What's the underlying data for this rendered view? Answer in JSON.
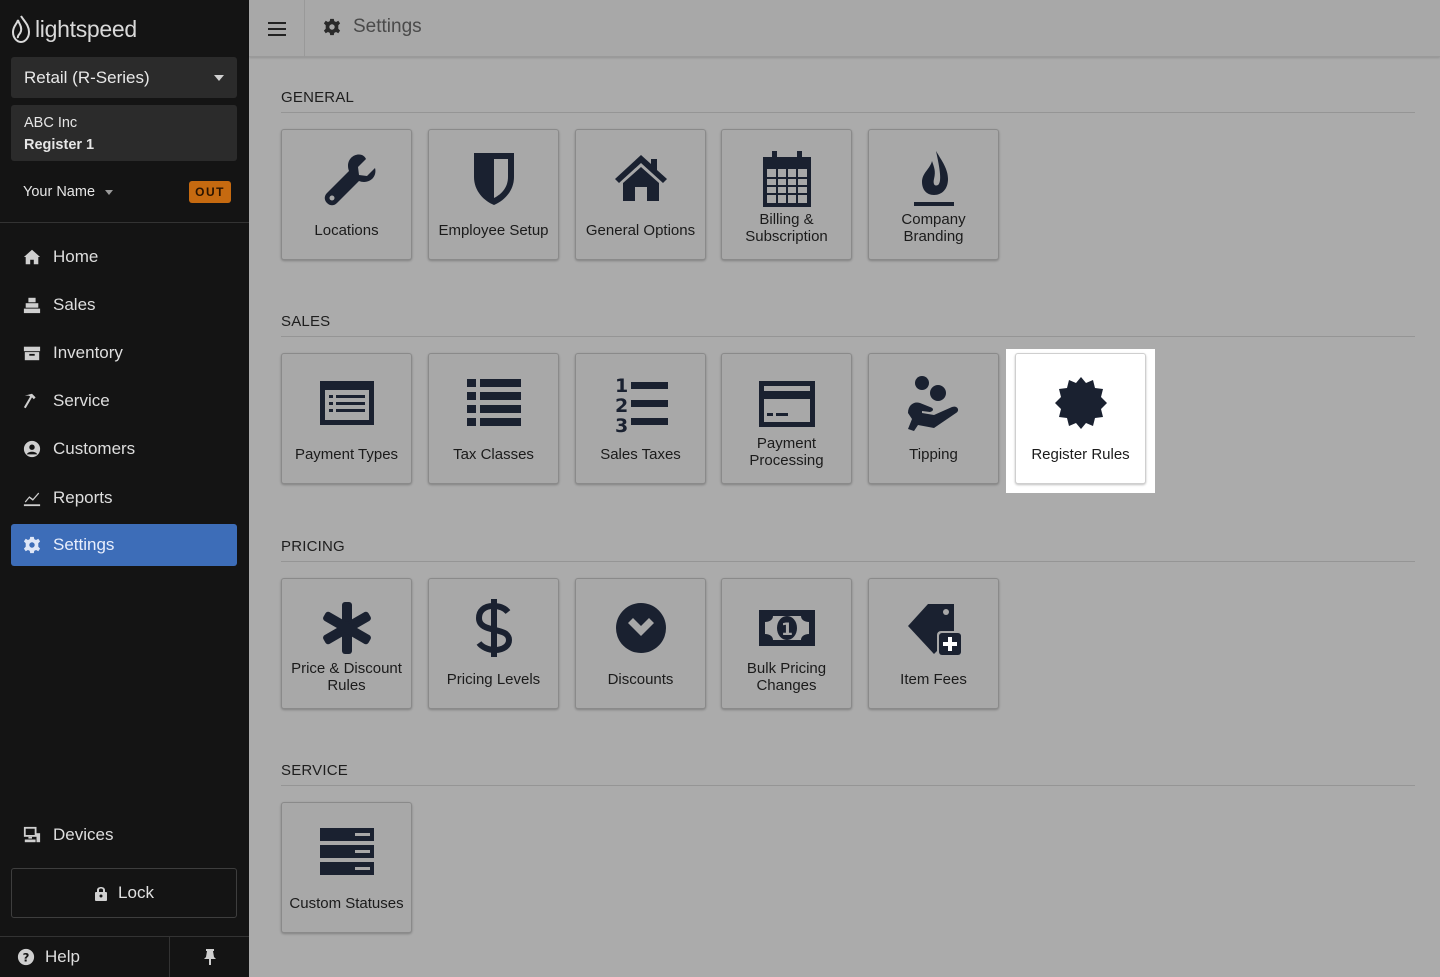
{
  "brand": {
    "name": "lightspeed"
  },
  "sidebar": {
    "product": "Retail (R-Series)",
    "account": {
      "company": "ABC Inc",
      "register": "Register 1"
    },
    "user": {
      "name": "Your Name",
      "status_badge": "OUT"
    },
    "nav": [
      {
        "label": "Home",
        "icon": "home-icon"
      },
      {
        "label": "Sales",
        "icon": "sales-icon"
      },
      {
        "label": "Inventory",
        "icon": "inventory-icon"
      },
      {
        "label": "Service",
        "icon": "service-icon"
      },
      {
        "label": "Customers",
        "icon": "customers-icon"
      },
      {
        "label": "Reports",
        "icon": "reports-icon"
      },
      {
        "label": "Settings",
        "icon": "gear-icon",
        "active": true
      }
    ],
    "devices": "Devices",
    "lock": "Lock",
    "help": "Help"
  },
  "header": {
    "title": "Settings"
  },
  "sections": {
    "general": {
      "title": "GENERAL",
      "tiles": [
        {
          "label": "Locations",
          "icon": "wrench-icon"
        },
        {
          "label": "Employee Setup",
          "icon": "shield-icon"
        },
        {
          "label": "General Options",
          "icon": "house-icon"
        },
        {
          "label": "Billing & Subscription",
          "icon": "calendar-icon"
        },
        {
          "label": "Company Branding",
          "icon": "flame-icon"
        }
      ]
    },
    "sales": {
      "title": "SALES",
      "tiles": [
        {
          "label": "Payment Types",
          "icon": "list-card-icon"
        },
        {
          "label": "Tax Classes",
          "icon": "list-icon"
        },
        {
          "label": "Sales Taxes",
          "icon": "numbered-list-icon"
        },
        {
          "label": "Payment Processing",
          "icon": "credit-card-icon"
        },
        {
          "label": "Tipping",
          "icon": "hand-coins-icon"
        },
        {
          "label": "Register Rules",
          "icon": "certificate-icon",
          "highlighted": true
        }
      ]
    },
    "pricing": {
      "title": "PRICING",
      "tiles": [
        {
          "label": "Price & Discount Rules",
          "icon": "asterisk-icon"
        },
        {
          "label": "Pricing Levels",
          "icon": "dollar-icon"
        },
        {
          "label": "Discounts",
          "icon": "chevron-circle-icon"
        },
        {
          "label": "Bulk Pricing Changes",
          "icon": "banknote-icon"
        },
        {
          "label": "Item Fees",
          "icon": "tag-plus-icon"
        }
      ]
    },
    "service": {
      "title": "SERVICE",
      "tiles": [
        {
          "label": "Custom Statuses",
          "icon": "server-icon"
        }
      ]
    }
  },
  "colors": {
    "sidebar_bg": "#141414",
    "active_nav": "#3d6db8",
    "out_badge": "#c66a10",
    "content_bg": "#ababab",
    "icon_fill": "#1a2130"
  }
}
